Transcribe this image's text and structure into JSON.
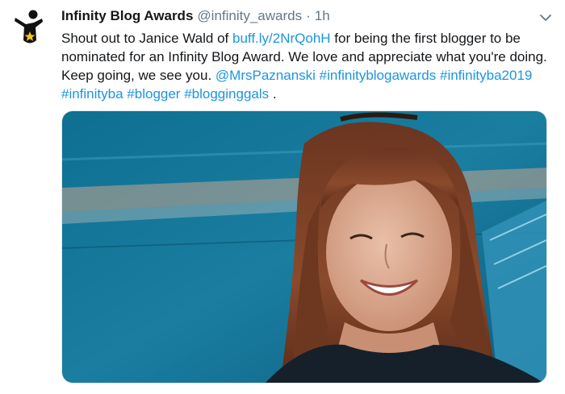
{
  "tweet": {
    "display_name": "Infinity Blog Awards",
    "handle": "@infinity_awards",
    "separator": "·",
    "time": "1h",
    "text_intro": "Shout out to Janice Wald of ",
    "link": "buff.ly/2NrQohH",
    "text_body": " for being the first blogger to be nominated for an Infinity Blog Award. We love and appreciate what you're doing. Keep going, we see you. ",
    "mention": "@MrsPaznanski",
    "hashtags": [
      "#infinityblogawards",
      "#infinityba2019",
      "#infinityba",
      "#blogger",
      "#blogginggals"
    ],
    "text_end": "."
  },
  "icons": {
    "avatar": "infinity-awards-logo",
    "caret": "chevron-down-icon",
    "media": "photo-of-smiling-woman"
  },
  "colors": {
    "link": "#1b95e0",
    "text": "#14171a",
    "muted": "#657786",
    "star": "#f5c518"
  }
}
